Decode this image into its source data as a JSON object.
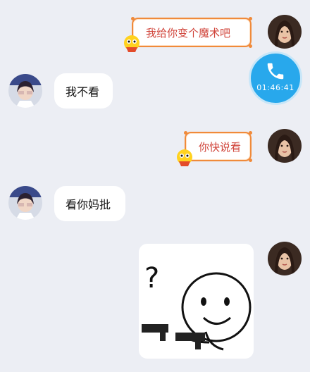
{
  "messages": [
    {
      "side": "right",
      "kind": "decorated",
      "text": "我给你变个魔术吧"
    },
    {
      "side": "left",
      "kind": "plain",
      "text": "我不看"
    },
    {
      "side": "right",
      "kind": "decorated",
      "text": "你快说看"
    },
    {
      "side": "left",
      "kind": "plain",
      "text": "看你妈批"
    },
    {
      "side": "right",
      "kind": "sticker",
      "text": "?"
    }
  ],
  "call": {
    "time": "01:46:41",
    "icon": "phone-icon",
    "color": "#28a8ec"
  },
  "colors": {
    "background": "#eceef4",
    "bubble": "#ffffff",
    "decorated_border": "#f08a3a",
    "decorated_text": "#d0443a"
  }
}
